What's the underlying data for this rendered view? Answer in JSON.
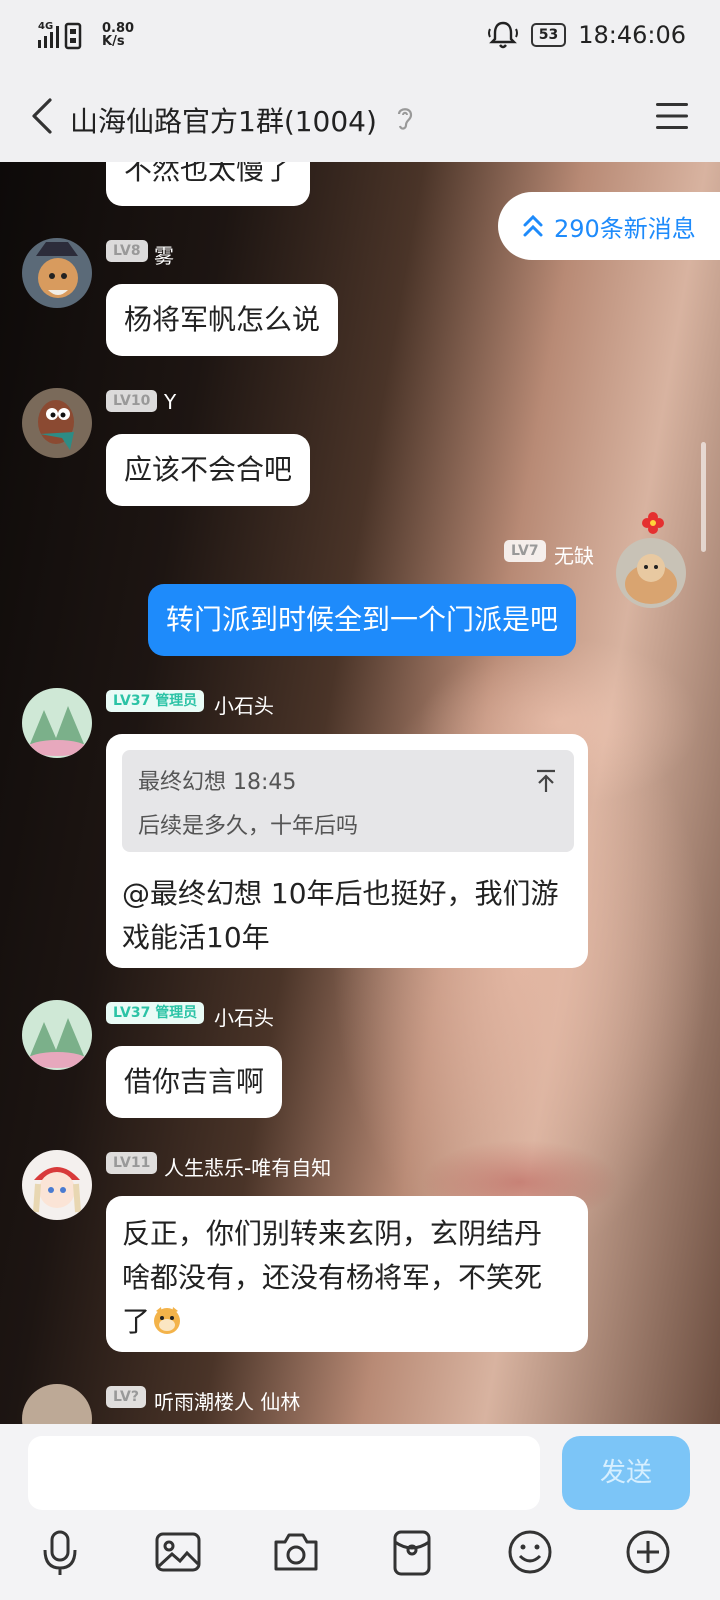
{
  "status": {
    "net": "4G",
    "speed_value": "0.80",
    "speed_unit": "K/s",
    "battery": "53",
    "time": "18:46:06"
  },
  "header": {
    "title": "山海仙路官方1群(1004)"
  },
  "new_messages": "290条新消息",
  "messages": [
    {
      "text": "不然也太慢了"
    },
    {
      "level": "LV8",
      "name": "雾",
      "text": "杨将军帆怎么说"
    },
    {
      "level": "LV10",
      "name": "Y",
      "text": "应该不会合吧"
    },
    {
      "level": "LV7",
      "name": "无缺",
      "text": "转门派到时候全到一个门派是吧"
    },
    {
      "level": "LV37",
      "role": "管理员",
      "name": "小石头",
      "quote_author": "最终幻想 18:45",
      "quote_text": "后续是多久，十年后吗",
      "line1": "@最终幻想 10年后也挺好，我们游",
      "line2": "戏能活10年"
    },
    {
      "level": "LV37",
      "role": "管理员",
      "name": "小石头",
      "text": "借你吉言啊"
    },
    {
      "level": "LV11",
      "name": "人生悲乐-唯有自知",
      "line1": "反正，你们别转来玄阴，玄阴结丹",
      "line2": "啥都没有，还没有杨将军，不笑死",
      "line3": "了"
    },
    {
      "level": "LV?",
      "name": "听雨潮楼人 仙林"
    }
  ],
  "composer": {
    "placeholder": "",
    "send_label": "发送"
  },
  "toolbar": [
    "microphone-icon",
    "image-icon",
    "camera-icon",
    "red-packet-icon",
    "emoji-icon",
    "plus-icon"
  ]
}
